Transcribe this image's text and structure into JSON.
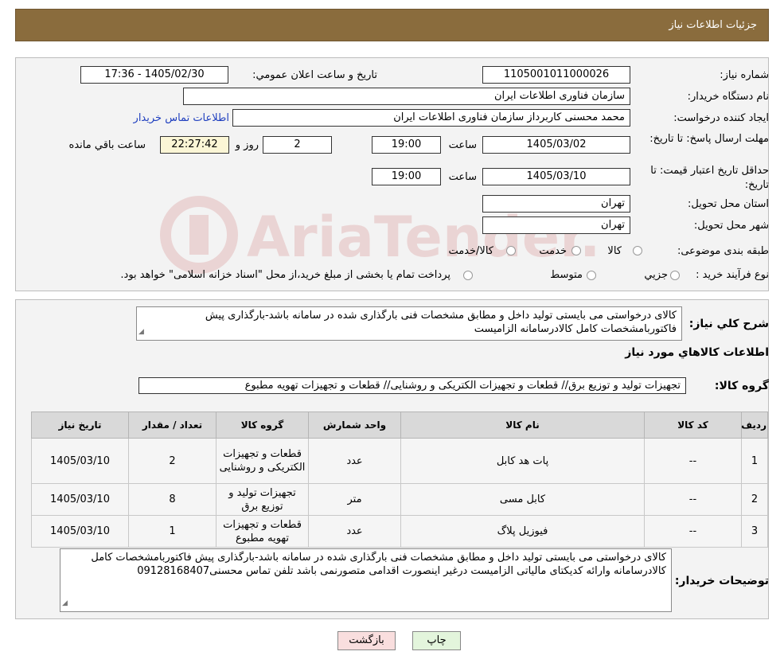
{
  "header": {
    "title": "جزئیات اطلاعات نیاز"
  },
  "info": {
    "need_number_label": "شماره نياز:",
    "need_number": "1105001011000026",
    "announce_label": "تاريخ و ساعت اعلان عمومي:",
    "announce_value": "1405/02/30 - 17:36",
    "buyer_org_label": "نام دستگاه خريدار:",
    "buyer_org": "سازمان فناوری اطلاعات ایران",
    "creator_label": "ايجاد کننده درخواست:",
    "creator": "محمد محسنی کاربرداز سازمان فناوری اطلاعات ایران",
    "contact_link": "اطلاعات تماس خريدار",
    "reply_label": "مهلت ارسال پاسخ: تا تاريخ:",
    "reply_date": "1405/03/02",
    "time_label": "ساعت",
    "reply_time": "19:00",
    "days_value": "2",
    "days_label": "روز و",
    "remaining_time": "22:27:42",
    "remaining_label": "ساعت باقي مانده",
    "validity_label": "حداقل تاريخ اعتبار قيمت: تا تاريخ:",
    "validity_date": "1405/03/10",
    "validity_time": "19:00",
    "province_label": "استان محل تحويل:",
    "province": "تهران",
    "city_label": "شهر محل تحويل:",
    "city": "تهران",
    "category_label": "طبقه بندی موضوعی:",
    "category_options": [
      "کالا",
      "خدمت",
      "کالا/خدمت"
    ],
    "process_label": "نوع فرآيند خريد :",
    "process_options": [
      "جزيي",
      "متوسط"
    ],
    "process_note": "پرداخت تمام یا بخشی از مبلغ خرید،از محل \"اسناد خزانه اسلامی\" خواهد بود."
  },
  "summary": {
    "label": "شرح کلي نياز:",
    "text": "کالای درخواستی می بایستی تولید داخل و مطابق مشخصات فنی بارگذاری شده در سامانه باشد-بارگذاری پیش فاکتوربامشخصات کامل کالادرسامانه الزامیست"
  },
  "goods_section": {
    "title": "اطلاعات کالاهاي مورد نياز",
    "group_label": "گروه کالا:",
    "group_value": "تجهیزات تولید و توزیع برق// قطعات و تجهیزات الکتریکی و روشنایی//  قطعات و تجهیزات تهویه مطبوع"
  },
  "table": {
    "headers": [
      "رديف",
      "کد کالا",
      "نام کالا",
      "واحد شمارش",
      "گروه کالا",
      "تعداد / مقدار",
      "تاريخ نياز"
    ],
    "rows": [
      [
        "1",
        "--",
        "پات هد کابل",
        "عدد",
        "قطعات و تجهیزات الکتریکی و روشنایی",
        "2",
        "1405/03/10"
      ],
      [
        "2",
        "--",
        "کابل مسی",
        "متر",
        "تجهیزات تولید و توزیع برق",
        "8",
        "1405/03/10"
      ],
      [
        "3",
        "--",
        "فیوزیل پلاگ",
        "عدد",
        "قطعات و تجهیزات تهویه مطبوع",
        "1",
        "1405/03/10"
      ]
    ]
  },
  "buyer_notes": {
    "label": "توضيحات خريدار:",
    "text": "کالای درخواستی می بایستی تولید داخل و مطابق مشخصات فنی بارگذاری شده در سامانه باشد-بارگذاری پیش فاکتوربامشخصات کامل کالادرسامانه وارائه کدیکتای مالیاتی الزامیست درغیر اینصورت اقدامی متصورنمی باشد تلفن تماس محسنی09128168407"
  },
  "buttons": {
    "print": "چاپ",
    "back": "بازگشت"
  },
  "watermark": {
    "text": "AriaTender.neT"
  },
  "colors": {
    "header_bg": "#8a6c3d",
    "print_btn": "#e3f5dc",
    "back_btn": "#f9dede",
    "link": "#1f3fbf"
  }
}
